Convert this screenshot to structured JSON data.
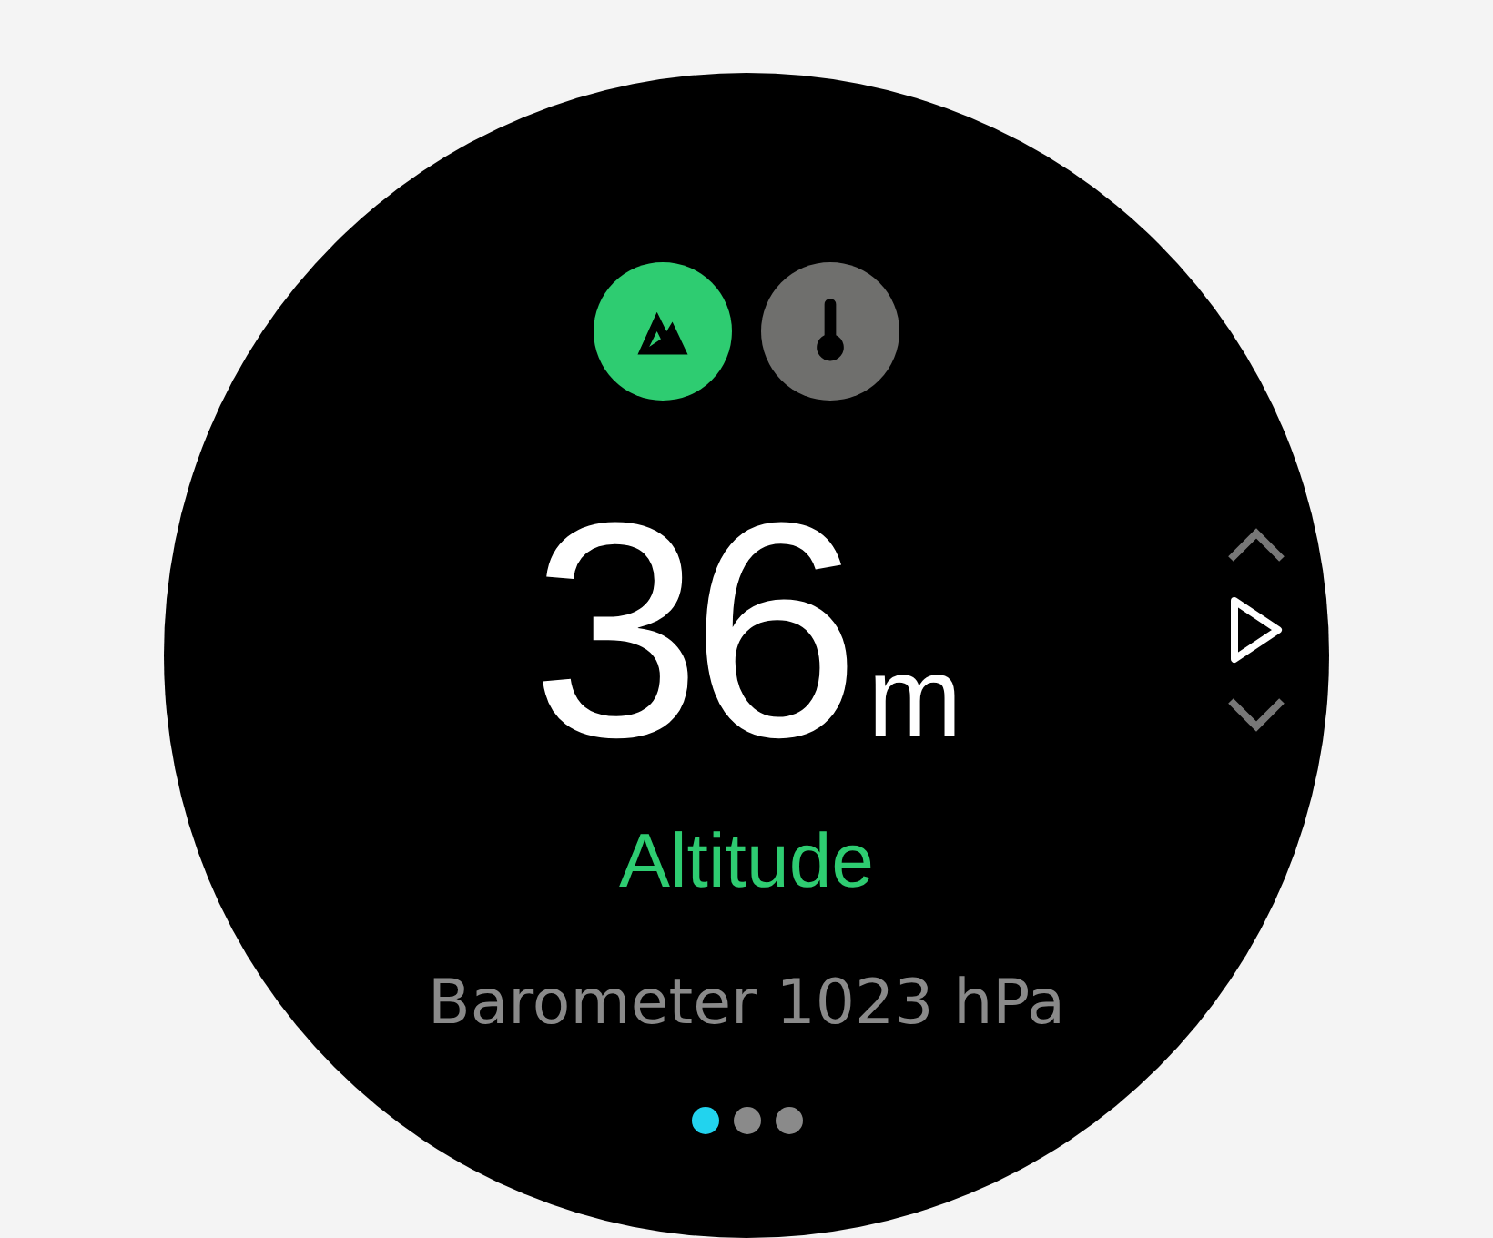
{
  "mode_icons": [
    {
      "kind": "mountain",
      "selected": true
    },
    {
      "kind": "thermometer",
      "selected": false
    }
  ],
  "reading": {
    "value": "36",
    "unit": "m"
  },
  "label": "Altitude",
  "secondary": "Barometer 1023 hPa",
  "page_dots": [
    {
      "selected": true
    },
    {
      "selected": false
    },
    {
      "selected": false
    }
  ]
}
